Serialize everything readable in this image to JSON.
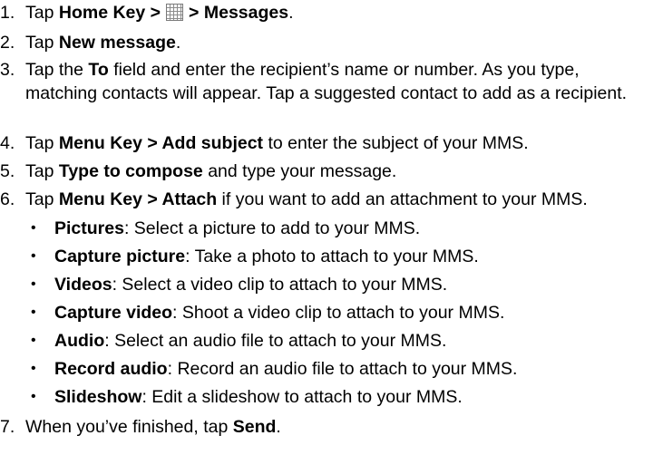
{
  "steps": [
    {
      "num": "1.",
      "pre": "Tap ",
      "bold1": "Home Key >",
      "icon": "apps-grid-icon",
      "bold2": "> Messages",
      "post": "."
    },
    {
      "num": "2.",
      "pre": "Tap ",
      "bold": "New message",
      "post": "."
    },
    {
      "num": "3.",
      "pre": "Tap the ",
      "bold": "To",
      "post": " field and enter the recipient’s name or number. As you type, matching contacts will appear. Tap a suggested contact to add as a recipient."
    },
    {
      "num": "4.",
      "pre": "Tap ",
      "bold": "Menu Key > Add subject",
      "post": " to enter the subject of your MMS."
    },
    {
      "num": "5.",
      "pre": "Tap ",
      "bold": "Type to compose",
      "post": " and type your message."
    },
    {
      "num": "6.",
      "pre": "Tap ",
      "bold": "Menu Key > Attach",
      "post": " if you want to add an attachment to your MMS."
    },
    {
      "num": "7.",
      "pre": "When you’ve finished, tap ",
      "bold": "Send",
      "post": "."
    }
  ],
  "bullet_glyph": "•",
  "attachments": [
    {
      "bold": "Pictures",
      "post": ": Select a picture to add to your MMS."
    },
    {
      "bold": "Capture picture",
      "post": ": Take a photo to attach to your MMS."
    },
    {
      "bold": "Videos",
      "post": ": Select a video clip to attach to your MMS."
    },
    {
      "bold": "Capture video",
      "post": ": Shoot a video clip to attach to your MMS."
    },
    {
      "bold": "Audio",
      "post": ": Select an audio file to attach to your MMS."
    },
    {
      "bold": "Record audio",
      "post": ": Record an audio file to attach to your MMS."
    },
    {
      "bold": "Slideshow",
      "post": ": Edit a slideshow to attach to your MMS."
    }
  ]
}
